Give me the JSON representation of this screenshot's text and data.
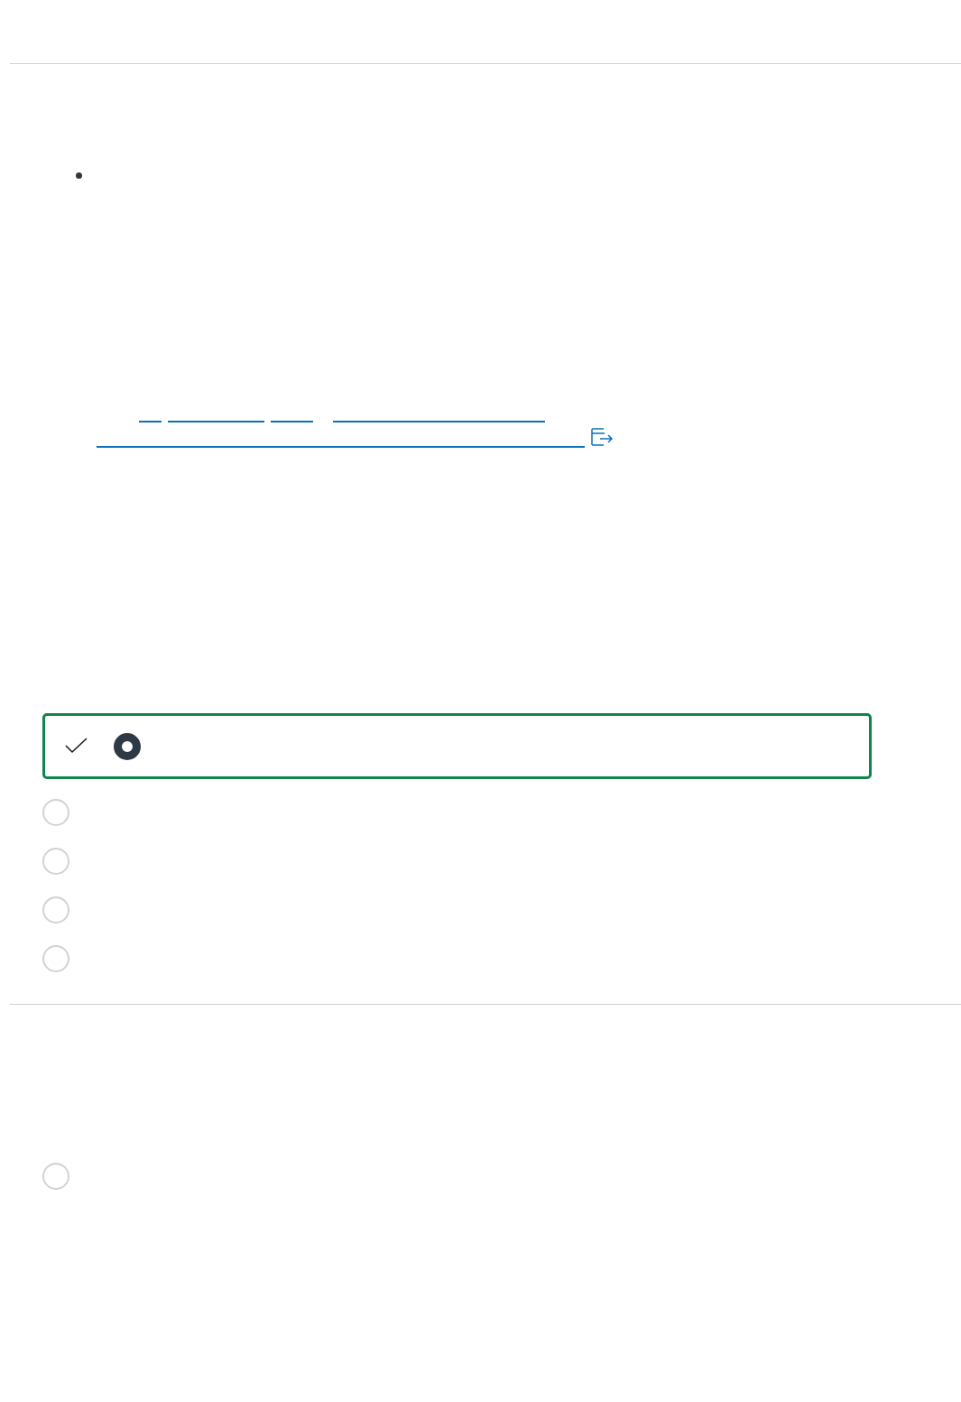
{
  "questions": [
    {
      "bullet": true,
      "link": {
        "external": true
      },
      "options": [
        {
          "selected": true,
          "correct": true
        },
        {
          "selected": false
        },
        {
          "selected": false
        },
        {
          "selected": false
        },
        {
          "selected": false
        }
      ]
    },
    {
      "options": [
        {
          "selected": false
        }
      ]
    }
  ]
}
